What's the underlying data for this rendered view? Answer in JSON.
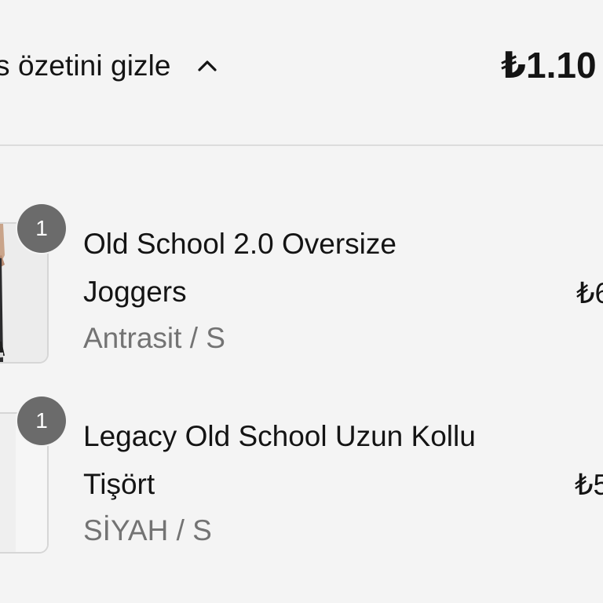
{
  "summary": {
    "toggle_label": "s özetini gizle",
    "chevron_icon": "chevron-up-icon",
    "total": "₺1.10"
  },
  "items": [
    {
      "quantity": "1",
      "name_line1": "Old School 2.0 Oversize",
      "name_line2": "Joggers",
      "variant": "Antrasit / S",
      "price": "₺6",
      "thumbnail_icon": "joggers-product-image"
    },
    {
      "quantity": "1",
      "name_line1": "Legacy Old School Uzun Kollu",
      "name_line2": "Tişört",
      "variant": "SİYAH / S",
      "price": "₺5",
      "thumbnail_icon": "tshirt-product-image"
    }
  ],
  "colors": {
    "background": "#f4f4f4",
    "text": "#141414",
    "muted_text": "#737373",
    "badge": "#6b6b6b",
    "divider": "#dcdcdc"
  }
}
